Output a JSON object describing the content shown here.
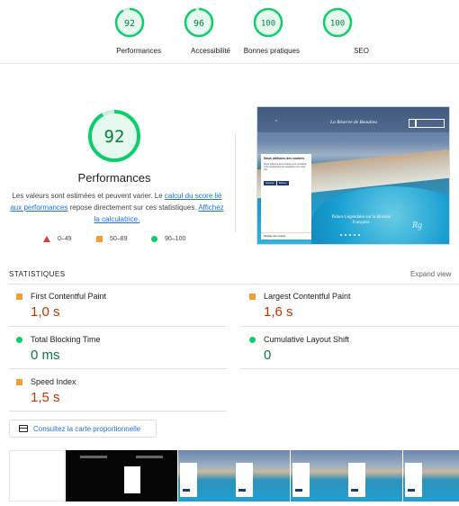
{
  "summary_gauges": [
    {
      "score": "92",
      "label": "Performances"
    },
    {
      "score": "96",
      "label": "Accessibilité"
    },
    {
      "score": "100",
      "label": "Bonnes pratiques"
    },
    {
      "score": "100",
      "label": "SEO"
    }
  ],
  "colors": {
    "pass": "#0cce6b",
    "average": "#f4a031",
    "fail": "#e53935",
    "link": "#1a73e8"
  },
  "performance": {
    "score": "92",
    "title": "Performances",
    "desc_1": "Les valeurs sont estimées et peuvent varier. Le ",
    "desc_link_1": "calcul du score lié aux performances",
    "desc_2": " repose directement sur ces statistiques. ",
    "desc_link_2": "Affichez la calculatrice.",
    "legend": {
      "fail": "0–49",
      "average": "50–89",
      "pass": "90–100"
    }
  },
  "screenshot": {
    "brand": "La Réserve de Beaulieu",
    "cookie_title": "Nous utilisons des cookies",
    "cookie_text": "Nous utilisons des cookies pour améliorer votre expérience de navigation sur notre site.",
    "cookie_btn_accept": "Accepter",
    "cookie_btn_refuse": "Refuser",
    "cookie_foot": "Réglage des cookies",
    "tagline": "Palace Légendaire sur la Riviera Française"
  },
  "stats": {
    "title": "STATISTIQUES",
    "expand": "Expand view",
    "metrics": [
      {
        "name": "First Contentful Paint",
        "value": "1,0 s",
        "rating": "average"
      },
      {
        "name": "Largest Contentful Paint",
        "value": "1,6 s",
        "rating": "average"
      },
      {
        "name": "Total Blocking Time",
        "value": "0 ms",
        "rating": "pass"
      },
      {
        "name": "Cumulative Layout Shift",
        "value": "0",
        "rating": "pass"
      },
      {
        "name": "Speed Index",
        "value": "1,5 s",
        "rating": "average"
      }
    ]
  },
  "treemap": {
    "label": "Consultez la carte proportionnelle"
  }
}
